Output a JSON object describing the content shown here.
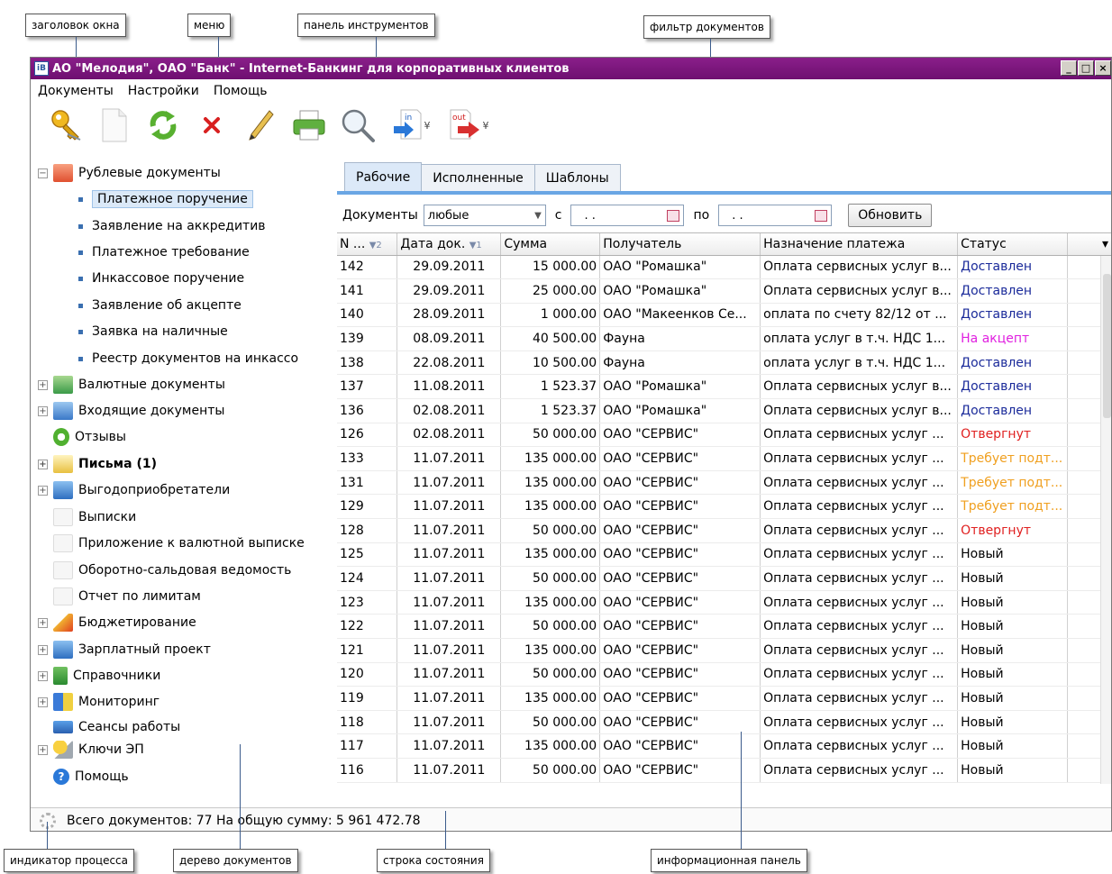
{
  "callouts": {
    "window_title": "заголовок окна",
    "menu": "меню",
    "toolbar": "панель инструментов",
    "doc_filter": "фильтр документов",
    "progress": "индикатор процесса",
    "doc_tree": "дерево документов",
    "statusbar": "строка состояния",
    "info_panel": "информационная панель"
  },
  "window": {
    "title": "АО \"Мелодия\", ОАО \"Банк\" - Internet-Банкинг для корпоративных клиентов"
  },
  "menu": [
    "Документы",
    "Настройки",
    "Помощь"
  ],
  "toolbar": {
    "icons": [
      "key-icon",
      "new-document-icon",
      "refresh-icon",
      "delete-icon",
      "edit-icon",
      "print-icon",
      "search-icon",
      "import-icon",
      "export-icon"
    ],
    "import_label": "in",
    "export_label": "out"
  },
  "tree": {
    "group_rub": "Рублевые документы",
    "rub_items": [
      "Платежное поручение",
      "Заявление на аккредитив",
      "Платежное требование",
      "Инкассовое поручение",
      "Заявление об акцепте",
      "Заявка на наличные",
      "Реестр документов на инкассо"
    ],
    "currency": "Валютные документы",
    "incoming": "Входящие документы",
    "feedback": "Отзывы",
    "letters": "Письма (1)",
    "beneficiaries": "Выгодоприобретатели",
    "statements": "Выписки",
    "fx_attachment": "Приложение к валютной выписке",
    "turnover": "Оборотно-сальдовая ведомость",
    "limits": "Отчет по лимитам",
    "budgeting": "Бюджетирование",
    "payroll": "Зарплатный проект",
    "references": "Справочники",
    "monitoring": "Мониторинг",
    "sessions": "Сеансы работы",
    "keys": "Ключи ЭП",
    "help": "Помощь"
  },
  "tabs": [
    "Рабочие",
    "Исполненные",
    "Шаблоны"
  ],
  "filter": {
    "docs_label": "Документы",
    "docs_value": "любые",
    "from_label": "с",
    "from_value": ". .",
    "to_label": "по",
    "to_value": ". .",
    "refresh": "Обновить"
  },
  "grid": {
    "headers": [
      "N ...",
      "Дата док.",
      "Сумма",
      "Получатель",
      "Назначение платежа",
      "Статус"
    ],
    "sort_marks": [
      "▼2",
      "▼1"
    ],
    "status_colors": {
      "Доставлен": "#1a2a9a",
      "На акцепт": "#e020e0",
      "Отвергнут": "#e02020",
      "Требует подт...": "#f0a020",
      "Новый": "#000000"
    },
    "rows": [
      [
        "142",
        "29.09.2011",
        "15 000.00",
        "ОАО \"Ромашка\"",
        "Оплата сервисных услуг в...",
        "Доставлен"
      ],
      [
        "141",
        "29.09.2011",
        "25 000.00",
        "ОАО \"Ромашка\"",
        "Оплата сервисных услуг в...",
        "Доставлен"
      ],
      [
        "140",
        "28.09.2011",
        "1 000.00",
        "ОАО \"Макеенков Се...",
        "оплата по счету 82/12 от ...",
        "Доставлен"
      ],
      [
        "139",
        "08.09.2011",
        "40 500.00",
        "Фауна",
        "оплата услуг в т.ч. НДС 1...",
        "На акцепт"
      ],
      [
        "138",
        "22.08.2011",
        "10 500.00",
        "Фауна",
        "оплата услуг в т.ч. НДС 1...",
        "Доставлен"
      ],
      [
        "137",
        "11.08.2011",
        "1 523.37",
        "ОАО \"Ромашка\"",
        "Оплата сервисных услуг в...",
        "Доставлен"
      ],
      [
        "136",
        "02.08.2011",
        "1 523.37",
        "ОАО \"Ромашка\"",
        "Оплата сервисных услуг в...",
        "Доставлен"
      ],
      [
        "126",
        "02.08.2011",
        "50 000.00",
        "ОАО \"СЕРВИС\"",
        "Оплата сервисных услуг ...",
        "Отвергнут"
      ],
      [
        "133",
        "11.07.2011",
        "135 000.00",
        "ОАО \"СЕРВИС\"",
        "Оплата сервисных услуг ...",
        "Требует подт..."
      ],
      [
        "131",
        "11.07.2011",
        "135 000.00",
        "ОАО \"СЕРВИС\"",
        "Оплата сервисных услуг ...",
        "Требует подт..."
      ],
      [
        "129",
        "11.07.2011",
        "135 000.00",
        "ОАО \"СЕРВИС\"",
        "Оплата сервисных услуг ...",
        "Требует подт..."
      ],
      [
        "128",
        "11.07.2011",
        "50 000.00",
        "ОАО \"СЕРВИС\"",
        "Оплата сервисных услуг ...",
        "Отвергнут"
      ],
      [
        "125",
        "11.07.2011",
        "135 000.00",
        "ОАО \"СЕРВИС\"",
        "Оплата сервисных услуг ...",
        "Новый"
      ],
      [
        "124",
        "11.07.2011",
        "50 000.00",
        "ОАО \"СЕРВИС\"",
        "Оплата сервисных услуг ...",
        "Новый"
      ],
      [
        "123",
        "11.07.2011",
        "135 000.00",
        "ОАО \"СЕРВИС\"",
        "Оплата сервисных услуг ...",
        "Новый"
      ],
      [
        "122",
        "11.07.2011",
        "50 000.00",
        "ОАО \"СЕРВИС\"",
        "Оплата сервисных услуг ...",
        "Новый"
      ],
      [
        "121",
        "11.07.2011",
        "135 000.00",
        "ОАО \"СЕРВИС\"",
        "Оплата сервисных услуг ...",
        "Новый"
      ],
      [
        "120",
        "11.07.2011",
        "50 000.00",
        "ОАО \"СЕРВИС\"",
        "Оплата сервисных услуг ...",
        "Новый"
      ],
      [
        "119",
        "11.07.2011",
        "135 000.00",
        "ОАО \"СЕРВИС\"",
        "Оплата сервисных услуг ...",
        "Новый"
      ],
      [
        "118",
        "11.07.2011",
        "50 000.00",
        "ОАО \"СЕРВИС\"",
        "Оплата сервисных услуг ...",
        "Новый"
      ],
      [
        "117",
        "11.07.2011",
        "135 000.00",
        "ОАО \"СЕРВИС\"",
        "Оплата сервисных услуг ...",
        "Новый"
      ],
      [
        "116",
        "11.07.2011",
        "50 000.00",
        "ОАО \"СЕРВИС\"",
        "Оплата сервисных услуг ...",
        "Новый"
      ]
    ]
  },
  "status": {
    "text": "Всего документов: 77 На общую сумму: 5 961 472.78"
  }
}
